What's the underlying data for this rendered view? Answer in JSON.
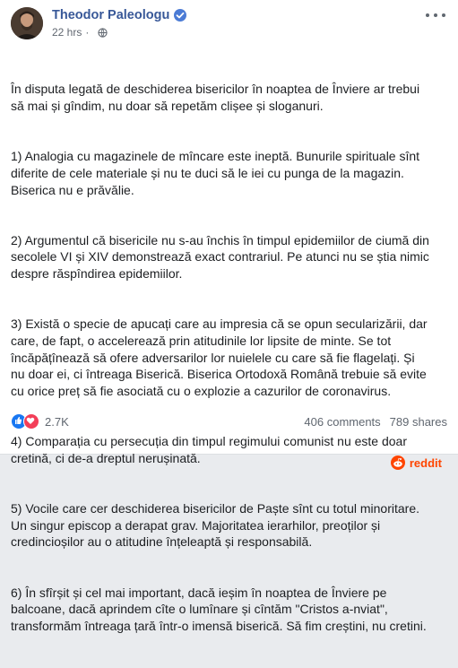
{
  "post": {
    "author": "Theodor Paleologu",
    "time": "22 hrs",
    "paragraphs": [
      "În disputa legată de deschiderea bisericilor în noaptea de Înviere ar trebui\nsă mai și gîndim, nu doar să repetăm clișee și sloganuri.",
      "1) Analogia cu magazinele de mîncare este ineptă. Bunurile spirituale sînt\ndiferite de cele materiale și nu te duci să le iei cu punga de la magazin.\nBiserica nu e prăvălie.",
      "2) Argumentul că bisericile nu s-au închis în timpul epidemiilor de ciumă din\nsecolele VI și XIV demonstrează exact contrariul. Pe atunci nu se știa nimic\ndespre răspîndirea epidemiilor.",
      "3) Există o specie de apucați care au impresia că se opun secularizării, dar\ncare, de fapt, o accelerează prin atitudinile lor lipsite de minte. Se tot\nîncăpățînează să ofere adversarilor lor nuielele cu care să fie flagelați. Și\nnu doar ei, ci întreaga Biserică. Biserica Ortodoxă Română trebuie să evite\ncu orice preț să fie asociată cu o explozie a cazurilor de coronavirus.",
      "4) Comparația cu persecuția din timpul regimului comunist nu este doar\ncretină, ci de-a dreptul nerușinată.",
      "5) Vocile care cer deschiderea bisericilor de Paște sînt cu totul minoritare.\nUn singur episcop a derapat grav. Majoritatea ierarhilor, preoților și\ncredincioșilor au o atitudine înțeleaptă și responsabilă.",
      "6) În sfîrșit și cel mai important, dacă ieșim în noaptea de Înviere pe\nbalcoane, dacă aprindem cîte o lumînare și cîntăm \"Cristos a-nviat\",\ntransformăm întreaga țară într-o imensă biserică. Să fim creștini, nu cretini."
    ],
    "reaction_count": "2.7K",
    "comments": "406 comments",
    "shares": "789 shares"
  },
  "watermark": "reddit",
  "icons": {
    "verified": "verified-badge-icon",
    "privacy": "globe-icon",
    "more": "more-options-icon",
    "like": "like-reaction-icon",
    "love": "love-reaction-icon",
    "reddit": "reddit-snoo-icon"
  },
  "colors": {
    "author": "#385898",
    "like": "#1877f2",
    "love": "#f33e58",
    "reddit": "#ff4500"
  }
}
